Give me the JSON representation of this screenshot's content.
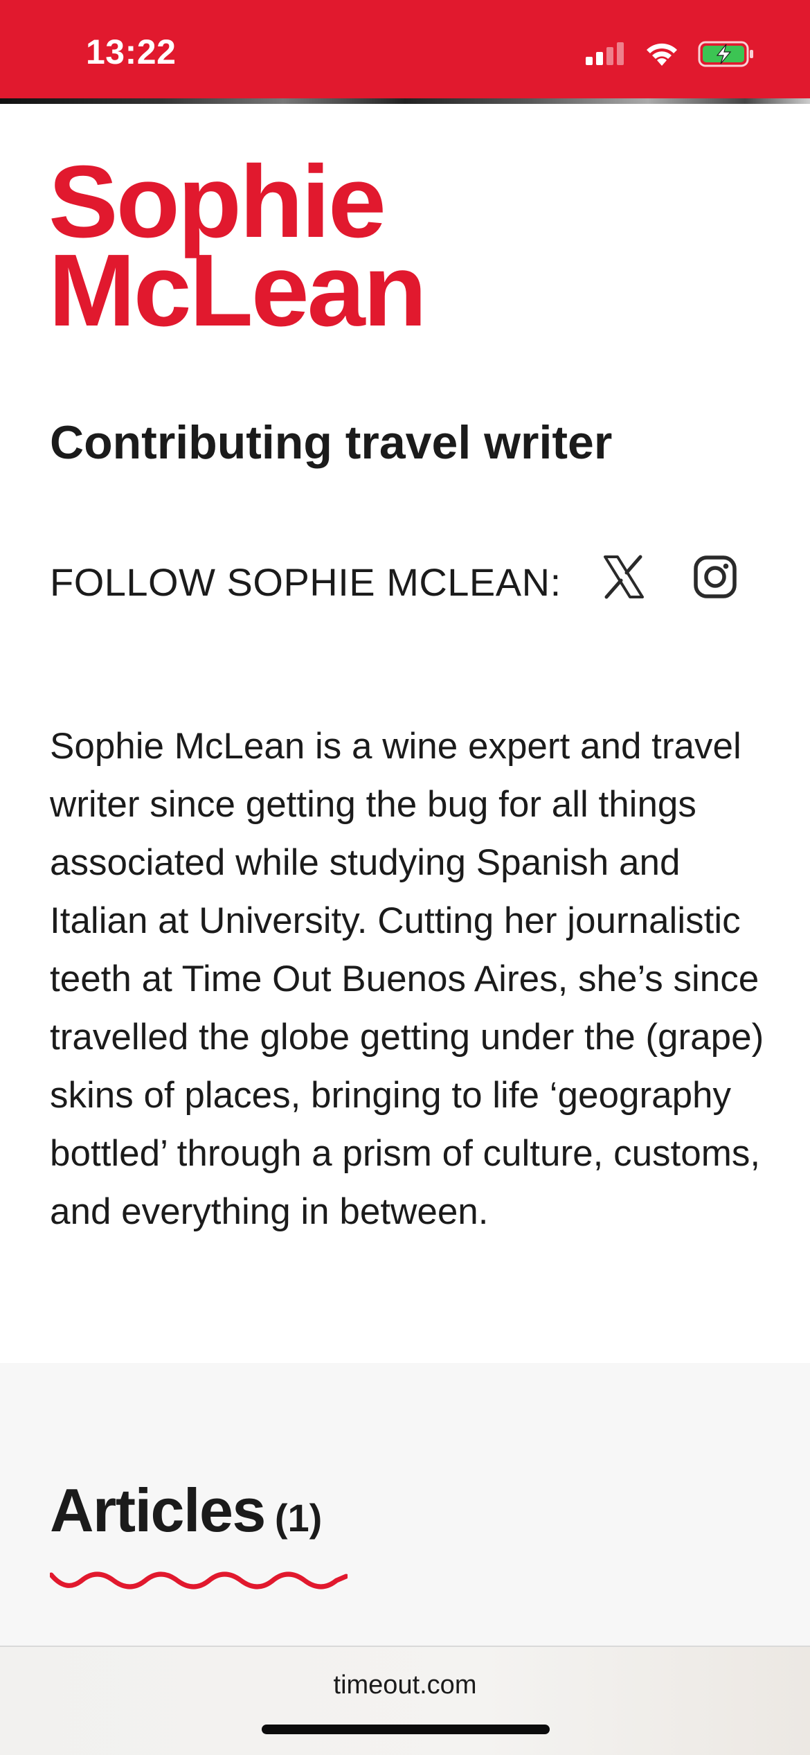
{
  "status_bar": {
    "time": "13:22",
    "icons": [
      "cellular-signal-icon",
      "wifi-icon",
      "battery-charging-icon"
    ],
    "background_color": "#e1192e"
  },
  "profile": {
    "first_name": "Sophie",
    "last_name": "McLean",
    "role": "Contributing travel writer",
    "follow_label": "FOLLOW SOPHIE MCLEAN:",
    "social": [
      {
        "icon": "x-twitter-icon"
      },
      {
        "icon": "instagram-icon"
      }
    ],
    "bio": "Sophie McLean is a wine expert and travel writer since getting the bug for all things associated while studying Spanish and Italian at University. Cutting her journalistic teeth at Time Out Buenos Aires, she’s since travelled the globe getting under the (grape) skins of places, bringing to life ‘geography bottled’ through a prism of culture, customs, and everything in between."
  },
  "articles": {
    "heading": "Articles",
    "count": "(1)"
  },
  "browser": {
    "url": "timeout.com"
  },
  "colors": {
    "brand": "#e1192e",
    "text": "#1b1b1b",
    "section_bg": "#f7f7f7"
  }
}
